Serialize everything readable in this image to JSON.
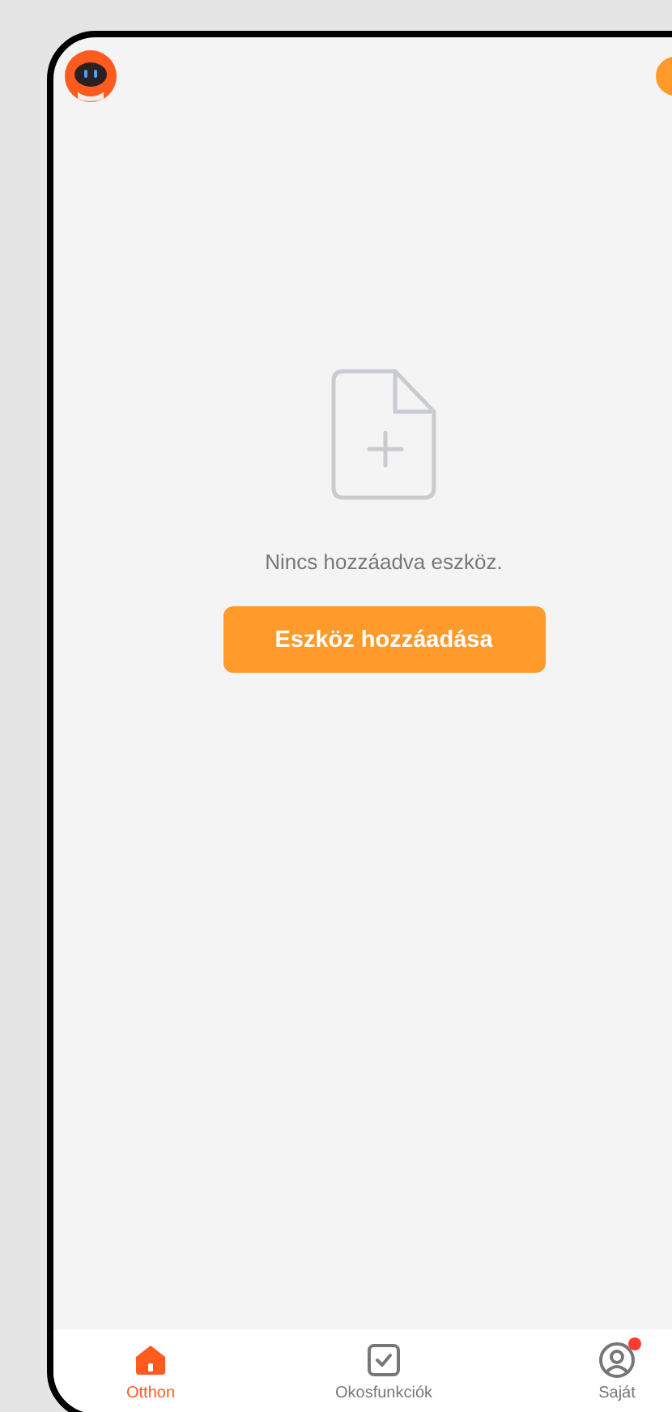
{
  "empty_state": {
    "message": "Nincs hozzáadva eszköz.",
    "button": "Eszköz hozzáadása"
  },
  "tabs": [
    {
      "label": "Otthon",
      "selected": true,
      "kind": "home"
    },
    {
      "label": "Okosfunkciók",
      "selected": false,
      "kind": "smart"
    },
    {
      "label": "Saját",
      "selected": false,
      "kind": "profile",
      "notification": true
    }
  ]
}
